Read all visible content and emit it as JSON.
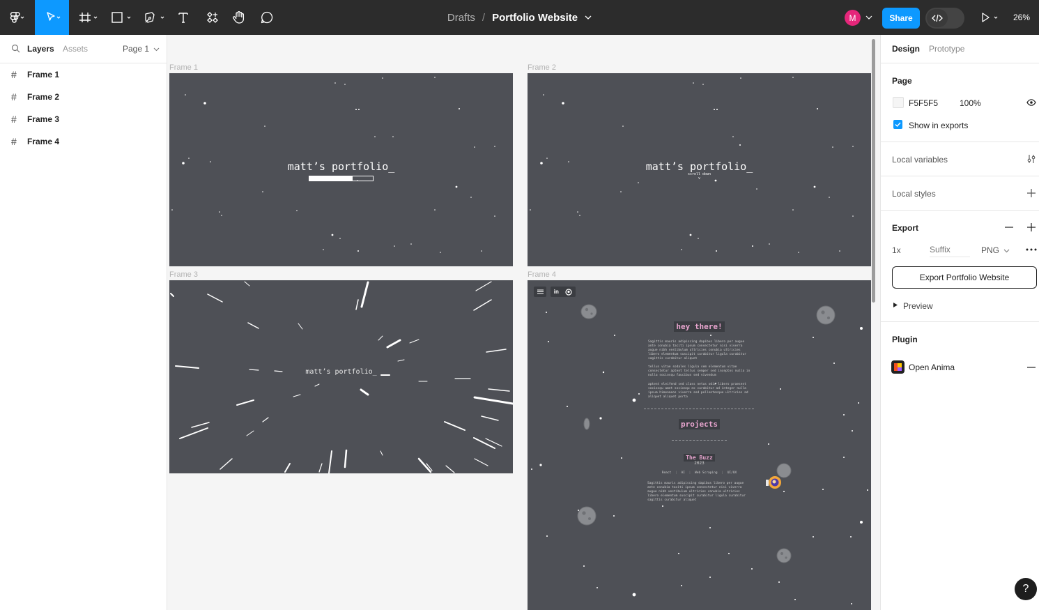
{
  "toolbar": {
    "tools": [
      "main-menu",
      "move",
      "frame",
      "shape",
      "pen",
      "text",
      "resources",
      "hand",
      "comment"
    ],
    "breadcrumb": {
      "project": "Drafts",
      "separator": "/",
      "file": "Portfolio Website"
    },
    "avatar_initial": "M",
    "share_label": "Share",
    "zoom": "26%",
    "colors": {
      "bar": "#2c2c2c",
      "accent": "#0d99ff",
      "avatar": "#e5267a"
    }
  },
  "left_panel": {
    "tabs": {
      "layers": "Layers",
      "assets": "Assets"
    },
    "page_selector": "Page 1",
    "layers": [
      {
        "label": "Frame 1"
      },
      {
        "label": "Frame 2"
      },
      {
        "label": "Frame 3"
      },
      {
        "label": "Frame 4"
      }
    ]
  },
  "canvas": {
    "frames": [
      {
        "label": "Frame 1",
        "title": "matt’s portfolio_",
        "loading_progress": 0.68
      },
      {
        "label": "Frame 2",
        "title": "matt’s portfolio_",
        "subtitle": "scroll down",
        "arrow": "v"
      },
      {
        "label": "Frame 3",
        "title": "matt’s portfolio_"
      },
      {
        "label": "Frame 4",
        "nav_icons": [
          "menu-icon",
          "linkedin-icon",
          "github-icon"
        ],
        "heading": "hey there!",
        "intro": [
          "Sagittis mauris adipiscing dapibus libero per augue ante conubia taciti ipsum consectetur nisi viverra augue nibh vestibulum ultricies conubia ultricies libero elementum suscipit curabitur ligula curabitur sagittis curabitur aliquet",
          "tellus vitae sodales ligula sem elementum vitae consectetur aptent tellus semper sed inceptos nulla in nulla sociosqu faucibus sed vivendum",
          "aptent eleifend sed class netus odio libero praesent sociosqu amet sociosqu ex curabitur ad integer nulla ipsum himenaeos viverra sed pellentesque ultricies ad aliquet aliquet porta"
        ],
        "projects_heading": "projects",
        "project": {
          "name": "The Buzz",
          "year": "2023",
          "tags": [
            "React",
            "AI",
            "Web Scraping",
            "UI/UX"
          ],
          "description": "Sagittis mauris adipiscing dapibus libero per augue ante conubia taciti ipsum consectetur nisi viverra augue nibh vestibulum ultricies conubia ultricies libero elementum suscipit curabitur ligula curabitur sagittis curabitur aliquet"
        }
      }
    ]
  },
  "right_panel": {
    "tabs": {
      "design": "Design",
      "prototype": "Prototype"
    },
    "page": {
      "title": "Page",
      "color_hex": "F5F5F5",
      "opacity": "100%",
      "show_in_exports": "Show in exports"
    },
    "local_variables": "Local variables",
    "local_styles": "Local styles",
    "export": {
      "title": "Export",
      "scale": "1x",
      "suffix_placeholder": "Suffix",
      "format": "PNG",
      "button": "Export Portfolio Website",
      "preview": "Preview"
    },
    "plugin": {
      "title": "Plugin",
      "name": "Open Anima"
    }
  },
  "help_label": "?"
}
